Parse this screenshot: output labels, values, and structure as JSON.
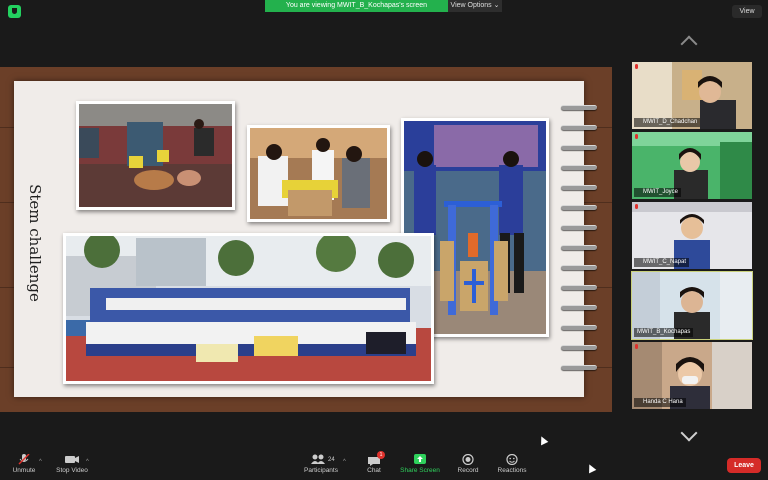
{
  "share_banner": "You are viewing MWIT_B_Kochapas's screen",
  "view_options": "View Options ⌄",
  "view_button": "View",
  "slide": {
    "title": "Stem challenge",
    "photos": [
      "robot-workshop-photo",
      "students-building-photo",
      "robot-structure-photo",
      "group-photo"
    ]
  },
  "participants": [
    {
      "name": "MWIT_D_Chadchan",
      "muted": true
    },
    {
      "name": "MWIT_Joyce",
      "muted": true
    },
    {
      "name": "MWIT_C_Napat",
      "muted": true
    },
    {
      "name": "MWIT_B_Kochapas",
      "muted": false
    },
    {
      "name": "Handa C Hana",
      "muted": true
    }
  ],
  "toolbar": {
    "unmute": "Unmute",
    "stop_video": "Stop Video",
    "participants": "Participants",
    "participants_count": "24",
    "chat": "Chat",
    "chat_badge": "1",
    "share_screen": "Share Screen",
    "record": "Record",
    "reactions": "Reactions",
    "leave": "Leave"
  },
  "colors": {
    "share_green": "#23b14d",
    "leave_red": "#d52b28",
    "active_speaker": "#c9d17a",
    "wood": "#6b3f28"
  }
}
